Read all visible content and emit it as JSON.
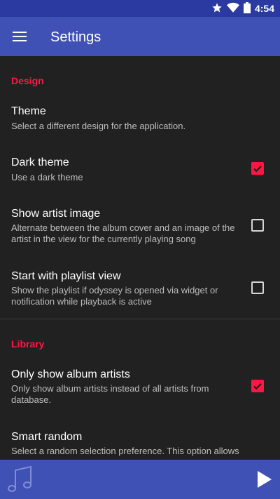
{
  "status": {
    "time": "4:54"
  },
  "appbar": {
    "title": "Settings",
    "menu_icon": "hamburger-menu-icon"
  },
  "sections": {
    "design": {
      "header": "Design",
      "theme": {
        "title": "Theme",
        "summary": "Select a different design for the application."
      },
      "dark_theme": {
        "title": "Dark theme",
        "summary": "Use a dark theme",
        "checked": true
      },
      "show_artist_image": {
        "title": "Show artist image",
        "summary": "Alternate between the album cover and an image of the artist in the view for the currently playing song",
        "checked": false
      },
      "start_playlist": {
        "title": "Start with playlist view",
        "summary": "Show the playlist if odyssey is opened via widget or notification while playback is active",
        "checked": false
      }
    },
    "library": {
      "header": "Library",
      "album_artists": {
        "title": "Only show album artists",
        "summary": "Only show album artists instead of all artists from database.",
        "checked": true
      },
      "smart_random": {
        "title": "Smart random",
        "summary": "Select a random selection preference. This option allows"
      }
    }
  },
  "colors": {
    "accent": "#ff1744",
    "primary": "#3f51b5",
    "primary_dark": "#2b3aa0",
    "background": "#212121"
  }
}
